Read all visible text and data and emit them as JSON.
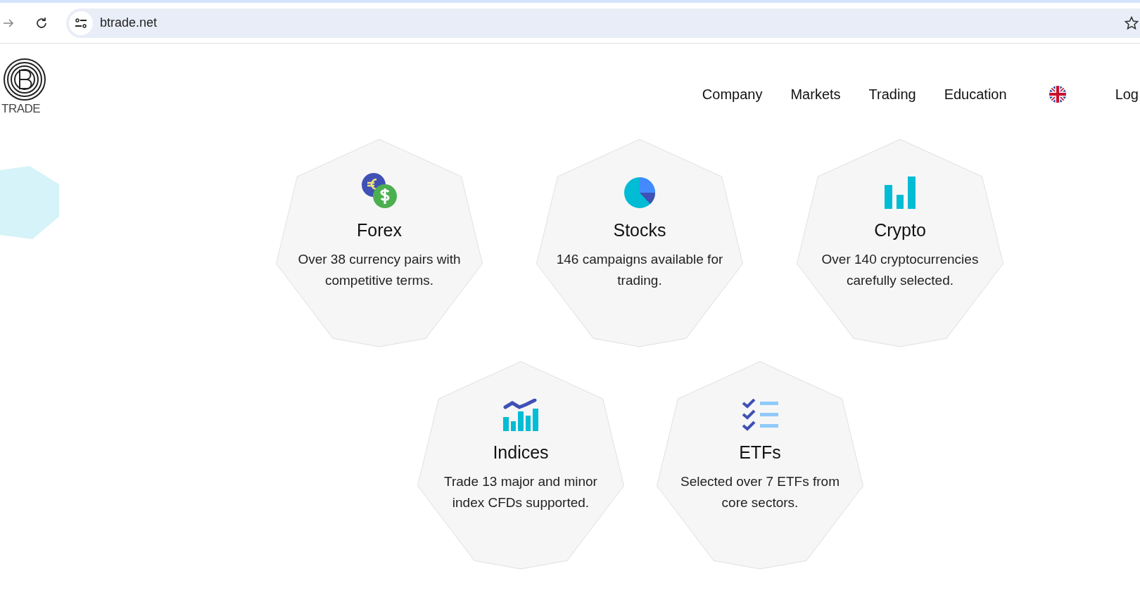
{
  "browser": {
    "url": "btrade.net"
  },
  "logo": {
    "text": "TRADE"
  },
  "nav": [
    {
      "label": "Company"
    },
    {
      "label": "Markets"
    },
    {
      "label": "Trading"
    },
    {
      "label": "Education"
    },
    {
      "kind": "flag"
    },
    {
      "label": "Log"
    }
  ],
  "markets": [
    {
      "kind": "forex",
      "title": "Forex",
      "text": "Over 38 currency pairs with competitive terms."
    },
    {
      "kind": "stocks",
      "title": "Stocks",
      "text": "146 campaigns available for trading."
    },
    {
      "kind": "crypto",
      "title": "Crypto",
      "text": "Over 140 cryptocurrencies carefully selected."
    },
    {
      "kind": "indices",
      "title": "Indices",
      "text": "Trade 13 major and minor index CFDs supported."
    },
    {
      "kind": "etfs",
      "title": "ETFs",
      "text": "Selected over 7 ETFs from core sectors."
    }
  ]
}
